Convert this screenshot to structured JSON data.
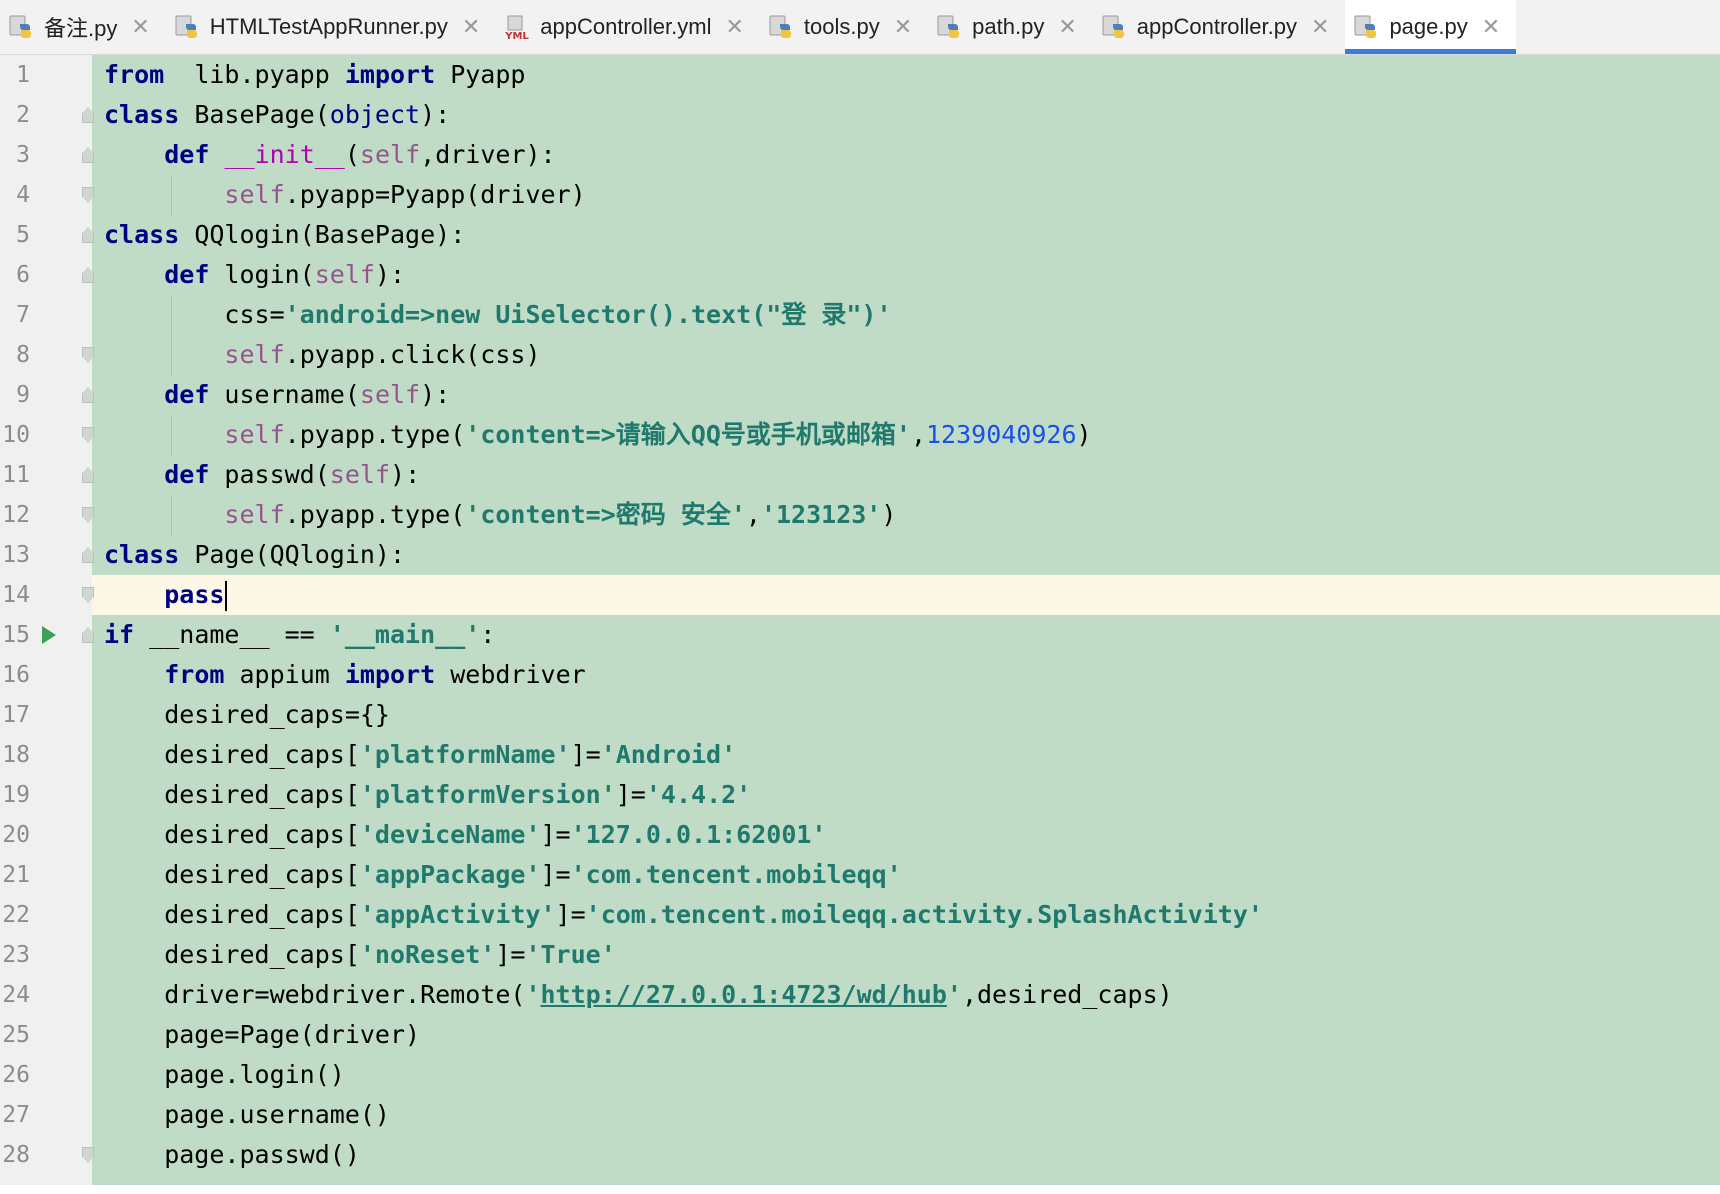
{
  "tabs": [
    {
      "label": "备注.py",
      "icon": "python-file-icon",
      "active": false
    },
    {
      "label": "HTMLTestAppRunner.py",
      "icon": "python-file-icon",
      "active": false
    },
    {
      "label": "appController.yml",
      "icon": "yml-file-icon",
      "active": false
    },
    {
      "label": "tools.py",
      "icon": "python-file-icon",
      "active": false
    },
    {
      "label": "path.py",
      "icon": "python-file-icon",
      "active": false
    },
    {
      "label": "appController.py",
      "icon": "python-file-icon",
      "active": false
    },
    {
      "label": "page.py",
      "icon": "python-file-icon",
      "active": true
    }
  ],
  "yml_badge": "YML",
  "colors": {
    "code_background": "#c0dcc6",
    "current_line": "#fdf8e6",
    "active_tab_underline": "#3f7cd8",
    "keyword": "#000080",
    "string": "#1f7a6d",
    "self": "#94558d",
    "number": "#1750eb",
    "run_icon": "#3aa05a"
  },
  "editor": {
    "current_line": 14,
    "run_marker_line": 15,
    "lines": [
      {
        "n": "1",
        "tokens": [
          [
            "kw",
            "from"
          ],
          [
            "",
            "  lib.pyapp "
          ],
          [
            "kw",
            "import"
          ],
          [
            "",
            " Pyapp"
          ]
        ]
      },
      {
        "n": "2",
        "tokens": [
          [
            "kw",
            "class"
          ],
          [
            "",
            " BasePage("
          ],
          [
            "builtin",
            "object"
          ],
          [
            "",
            "):"
          ]
        ]
      },
      {
        "n": "3",
        "tokens": [
          [
            "",
            "    "
          ],
          [
            "kw",
            "def"
          ],
          [
            "",
            " "
          ],
          [
            "magic",
            "__init__"
          ],
          [
            "",
            "("
          ],
          [
            "self",
            "self"
          ],
          [
            "",
            ",driver):"
          ]
        ]
      },
      {
        "n": "4",
        "tokens": [
          [
            "",
            "        "
          ],
          [
            "self",
            "self"
          ],
          [
            "",
            ".pyapp=Pyapp(driver)"
          ]
        ]
      },
      {
        "n": "5",
        "tokens": [
          [
            "kw",
            "class"
          ],
          [
            "",
            " QQlogin(BasePage):"
          ]
        ]
      },
      {
        "n": "6",
        "tokens": [
          [
            "",
            "    "
          ],
          [
            "kw",
            "def"
          ],
          [
            "",
            " login("
          ],
          [
            "self",
            "self"
          ],
          [
            "",
            "):"
          ]
        ]
      },
      {
        "n": "7",
        "tokens": [
          [
            "",
            "        css="
          ],
          [
            "str",
            "'android=>new UiSelector().text(\"登 录\")'"
          ]
        ]
      },
      {
        "n": "8",
        "tokens": [
          [
            "",
            "        "
          ],
          [
            "self",
            "self"
          ],
          [
            "",
            ".pyapp.click(css)"
          ]
        ]
      },
      {
        "n": "9",
        "tokens": [
          [
            "",
            "    "
          ],
          [
            "kw",
            "def"
          ],
          [
            "",
            " username("
          ],
          [
            "self",
            "self"
          ],
          [
            "",
            "):"
          ]
        ]
      },
      {
        "n": "10",
        "tokens": [
          [
            "",
            "        "
          ],
          [
            "self",
            "self"
          ],
          [
            "",
            ".pyapp.type("
          ],
          [
            "str",
            "'content=>请输入QQ号或手机或邮箱'"
          ],
          [
            "",
            ","
          ],
          [
            "num",
            "1239040926"
          ],
          [
            "",
            ")"
          ]
        ]
      },
      {
        "n": "11",
        "tokens": [
          [
            "",
            "    "
          ],
          [
            "kw",
            "def"
          ],
          [
            "",
            " passwd("
          ],
          [
            "self",
            "self"
          ],
          [
            "",
            "):"
          ]
        ]
      },
      {
        "n": "12",
        "tokens": [
          [
            "",
            "        "
          ],
          [
            "self",
            "self"
          ],
          [
            "",
            ".pyapp.type("
          ],
          [
            "str",
            "'content=>密码 安全'"
          ],
          [
            "",
            ","
          ],
          [
            "str",
            "'123123'"
          ],
          [
            "",
            ")"
          ]
        ]
      },
      {
        "n": "13",
        "tokens": [
          [
            "kw",
            "class"
          ],
          [
            "",
            " Page(QQlogin):"
          ]
        ]
      },
      {
        "n": "14",
        "tokens": [
          [
            "",
            "    "
          ],
          [
            "kw",
            "pass"
          ]
        ]
      },
      {
        "n": "15",
        "tokens": [
          [
            "kw",
            "if"
          ],
          [
            "",
            " __name__ == "
          ],
          [
            "str",
            "'__main__'"
          ],
          [
            "",
            ":"
          ]
        ]
      },
      {
        "n": "16",
        "tokens": [
          [
            "",
            "    "
          ],
          [
            "kw",
            "from"
          ],
          [
            "",
            " appium "
          ],
          [
            "kw",
            "import"
          ],
          [
            "",
            " webdriver"
          ]
        ]
      },
      {
        "n": "17",
        "tokens": [
          [
            "",
            "    desired_caps={}"
          ]
        ]
      },
      {
        "n": "18",
        "tokens": [
          [
            "",
            "    desired_caps["
          ],
          [
            "str",
            "'platformName'"
          ],
          [
            "",
            "]="
          ],
          [
            "str",
            "'Android'"
          ]
        ]
      },
      {
        "n": "19",
        "tokens": [
          [
            "",
            "    desired_caps["
          ],
          [
            "str",
            "'platformVersion'"
          ],
          [
            "",
            "]="
          ],
          [
            "str",
            "'4.4.2'"
          ]
        ]
      },
      {
        "n": "20",
        "tokens": [
          [
            "",
            "    desired_caps["
          ],
          [
            "str",
            "'deviceName'"
          ],
          [
            "",
            "]="
          ],
          [
            "str",
            "'127.0.0.1:62001'"
          ]
        ]
      },
      {
        "n": "21",
        "tokens": [
          [
            "",
            "    desired_caps["
          ],
          [
            "str",
            "'appPackage'"
          ],
          [
            "",
            "]="
          ],
          [
            "str",
            "'com.tencent.mobileqq'"
          ]
        ]
      },
      {
        "n": "22",
        "tokens": [
          [
            "",
            "    desired_caps["
          ],
          [
            "str",
            "'appActivity'"
          ],
          [
            "",
            "]="
          ],
          [
            "str",
            "'com.tencent.moileqq.activity.SplashActivity'"
          ]
        ]
      },
      {
        "n": "23",
        "tokens": [
          [
            "",
            "    desired_caps["
          ],
          [
            "str",
            "'noReset'"
          ],
          [
            "",
            "]="
          ],
          [
            "str",
            "'True'"
          ]
        ]
      },
      {
        "n": "24",
        "tokens": [
          [
            "",
            "    driver=webdriver.Remote("
          ],
          [
            "str",
            "'"
          ],
          [
            "url",
            "http://27.0.0.1:4723/wd/hub"
          ],
          [
            "str",
            "'"
          ],
          [
            "",
            ",desired_caps)"
          ]
        ]
      },
      {
        "n": "25",
        "tokens": [
          [
            "",
            "    page=Page(driver)"
          ]
        ]
      },
      {
        "n": "26",
        "tokens": [
          [
            "",
            "    page.login()"
          ]
        ]
      },
      {
        "n": "27",
        "tokens": [
          [
            "",
            "    page.username()"
          ]
        ]
      },
      {
        "n": "28",
        "tokens": [
          [
            "",
            "    page.passwd()"
          ]
        ]
      }
    ]
  }
}
